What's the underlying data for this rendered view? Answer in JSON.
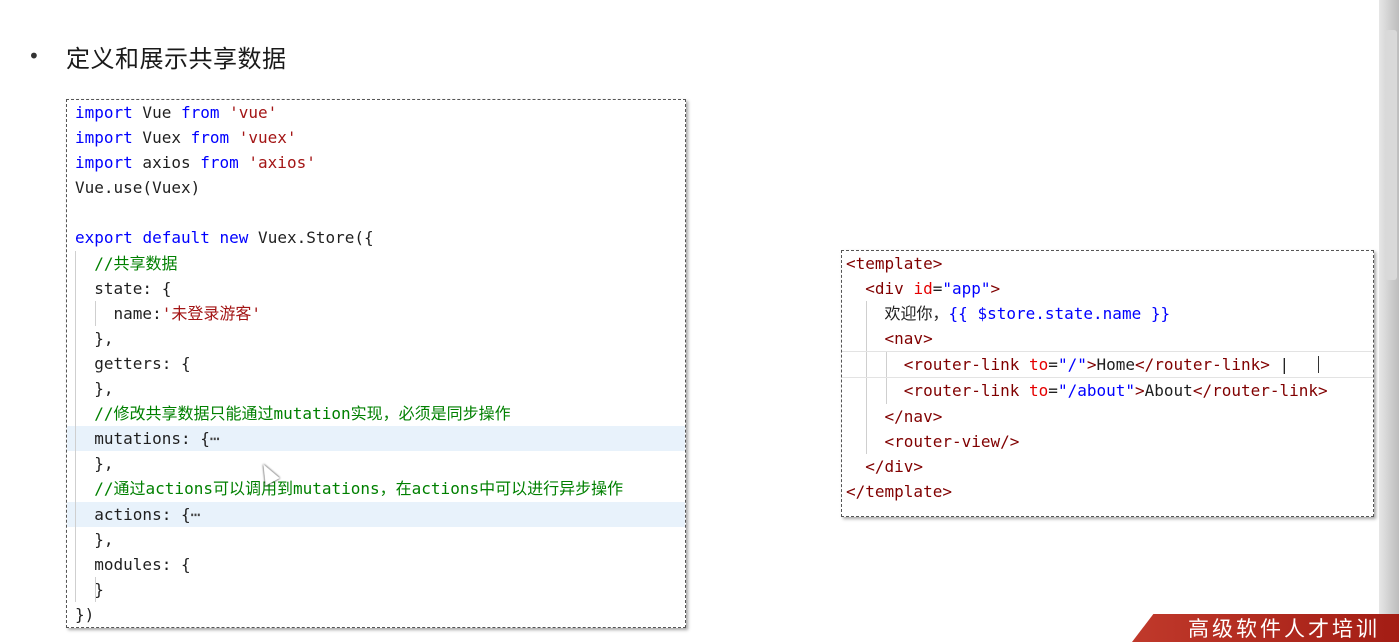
{
  "slide": {
    "bullet_symbol": "•",
    "heading": "定义和展示共享数据"
  },
  "store_code": {
    "l1": {
      "a": "import",
      "b": " Vue ",
      "c": "from",
      "d": " ",
      "e": "'vue'"
    },
    "l2": {
      "a": "import",
      "b": " Vuex ",
      "c": "from",
      "d": " ",
      "e": "'vuex'"
    },
    "l3": {
      "a": "import",
      "b": " axios ",
      "c": "from",
      "d": " ",
      "e": "'axios'"
    },
    "l4": "Vue.use(Vuex)",
    "l6": {
      "a": "export",
      "b": "default",
      "c": "new",
      "d": " Vuex.Store({"
    },
    "l7": "//共享数据",
    "l8": "state: {",
    "l9": {
      "key": "name:",
      "val": "'未登录游客'"
    },
    "l10": "},",
    "l11": "getters: {",
    "l12": "},",
    "l13": "//修改共享数据只能通过mutation实现，必须是同步操作",
    "l14": {
      "key": "mutations: {",
      "fold": "⋯"
    },
    "l15": "},",
    "l16": "//通过actions可以调用到mutations，在actions中可以进行异步操作",
    "l17": {
      "key": "actions: {",
      "fold": "⋯"
    },
    "l18": "},",
    "l19": "modules: {",
    "l20": "}",
    "l21": "})"
  },
  "template_code": {
    "t1": "<template>",
    "t2": {
      "open": "<div ",
      "attr": "id",
      "eq": "=",
      "val": "\"app\"",
      "close": ">"
    },
    "t3": {
      "text": "欢迎你，",
      "expr": "{{ $store.state.name }}"
    },
    "t4": "<nav>",
    "t5": {
      "open": "<router-link ",
      "attr": "to",
      "eq": "=",
      "val": "\"/\"",
      "close": ">",
      "text": "Home",
      "end": "</router-link>",
      "sep": " |"
    },
    "t6": {
      "open": "<router-link ",
      "attr": "to",
      "eq": "=",
      "val": "\"/about\"",
      "close": ">",
      "text": "About",
      "end": "</router-link>"
    },
    "t7": "</nav>",
    "t8": "<router-view/>",
    "t9": "</div>",
    "t10": "</template>"
  },
  "banner": {
    "text": "高级软件人才培训"
  },
  "colors": {
    "keyword": "#0000ff",
    "string": "#a31515",
    "comment": "#008000",
    "tag": "#800000",
    "attribute": "#e50000",
    "highlight": "#e8f2fb",
    "banner": "#c0392b"
  }
}
